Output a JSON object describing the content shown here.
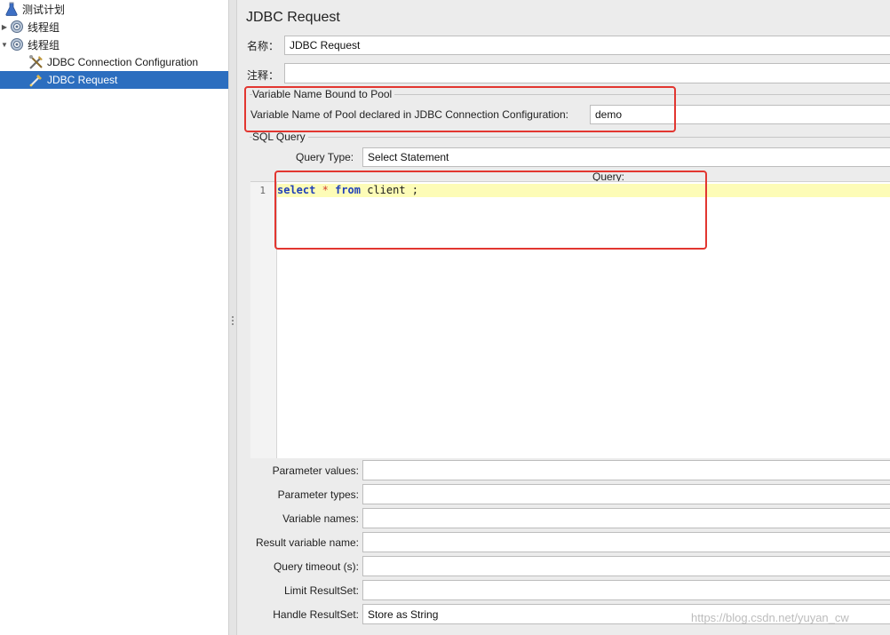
{
  "tree": {
    "items": [
      {
        "label": "测试计划",
        "icon": "flask-icon"
      },
      {
        "label": "线程组",
        "icon": "gear-icon",
        "expanded": false
      },
      {
        "label": "线程组",
        "icon": "gear-icon",
        "expanded": true
      },
      {
        "label": "JDBC Connection Configuration",
        "icon": "tools-icon"
      },
      {
        "label": "JDBC Request",
        "icon": "pipette-icon",
        "selected": true
      }
    ]
  },
  "panel": {
    "title": "JDBC Request",
    "name_label": "名称：",
    "name_value": "JDBC Request",
    "comment_label": "注释：",
    "comment_value": "",
    "pool_group_title": "Variable Name Bound to Pool",
    "pool_label": "Variable Name of Pool declared in JDBC Connection Configuration:",
    "pool_value": "demo",
    "sql_group_title": "SQL Query",
    "query_type_label": "Query Type:",
    "query_type_value": "Select Statement",
    "query_label": "Query:",
    "editor": {
      "line_number": "1",
      "tokens": [
        {
          "text": "select",
          "kind": "keyword"
        },
        {
          "text": " ",
          "kind": "space"
        },
        {
          "text": "*",
          "kind": "operator"
        },
        {
          "text": " ",
          "kind": "space"
        },
        {
          "text": "from",
          "kind": "keyword"
        },
        {
          "text": " ",
          "kind": "space"
        },
        {
          "text": "client",
          "kind": "identifier"
        },
        {
          "text": " ;",
          "kind": "identifier"
        }
      ]
    },
    "params": [
      {
        "label": "Parameter values:",
        "value": ""
      },
      {
        "label": "Parameter types:",
        "value": ""
      },
      {
        "label": "Variable names:",
        "value": ""
      },
      {
        "label": "Result variable name:",
        "value": ""
      },
      {
        "label": "Query timeout (s):",
        "value": ""
      },
      {
        "label": "Limit ResultSet:",
        "value": ""
      },
      {
        "label": "Handle ResultSet:",
        "value": "Store as String"
      }
    ]
  },
  "colors": {
    "selection": "#2c6ebf",
    "annotation_red": "#e23630",
    "keyword_blue": "#1f3fb8",
    "current_line": "#fdfcb7"
  },
  "watermark": "https://blog.csdn.net/yuyan_cw"
}
